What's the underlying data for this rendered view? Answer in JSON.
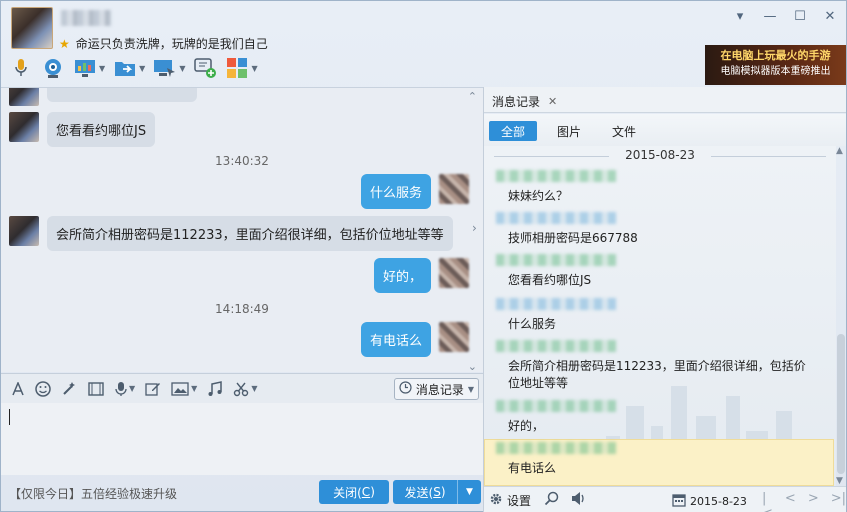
{
  "window": {
    "signature": "命运只负责洗牌，玩牌的是我们自己",
    "controls": {
      "dropdown": "▾",
      "minimize": "—",
      "maximize": "☐",
      "close": "✕"
    }
  },
  "ad": {
    "line1": "在电脑上玩最火的手游",
    "line2": "电脑模拟器版本重磅推出"
  },
  "chat": {
    "messages": [
      {
        "type": "in",
        "text": "您看看约哪位JS"
      },
      {
        "type": "time",
        "text": "13:40:32"
      },
      {
        "type": "out",
        "text": "什么服务"
      },
      {
        "type": "in",
        "text": "会所简介相册密码是112233，里面介绍很详细，包括价位地址等等"
      },
      {
        "type": "out",
        "text": "好的，"
      },
      {
        "type": "time",
        "text": "14:18:49"
      },
      {
        "type": "out",
        "text": "有电话么"
      }
    ]
  },
  "input_toolbar": {
    "history_label": "消息记录"
  },
  "footer": {
    "promo": "【仅限今日】五倍经验极速升级",
    "close_label": "关闭(",
    "close_key": "C",
    "close_end": ")",
    "send_label": "发送(",
    "send_key": "S",
    "send_end": ")"
  },
  "history_panel": {
    "tab_label": "消息记录",
    "filters": {
      "all": "全部",
      "pictures": "图片",
      "files": "文件"
    },
    "date": "2015-08-23",
    "records": [
      {
        "text": "妹妹约么？"
      },
      {
        "text": "技师相册密码是667788"
      },
      {
        "text": "您看看约哪位JS"
      },
      {
        "text": "什么服务"
      },
      {
        "text": "会所简介相册密码是112233，里面介绍很详细，包括价位地址等等"
      },
      {
        "text": "好的，"
      },
      {
        "text": "有电话么"
      }
    ],
    "settings_label": "设置",
    "date_picker": "2015-8-23"
  }
}
